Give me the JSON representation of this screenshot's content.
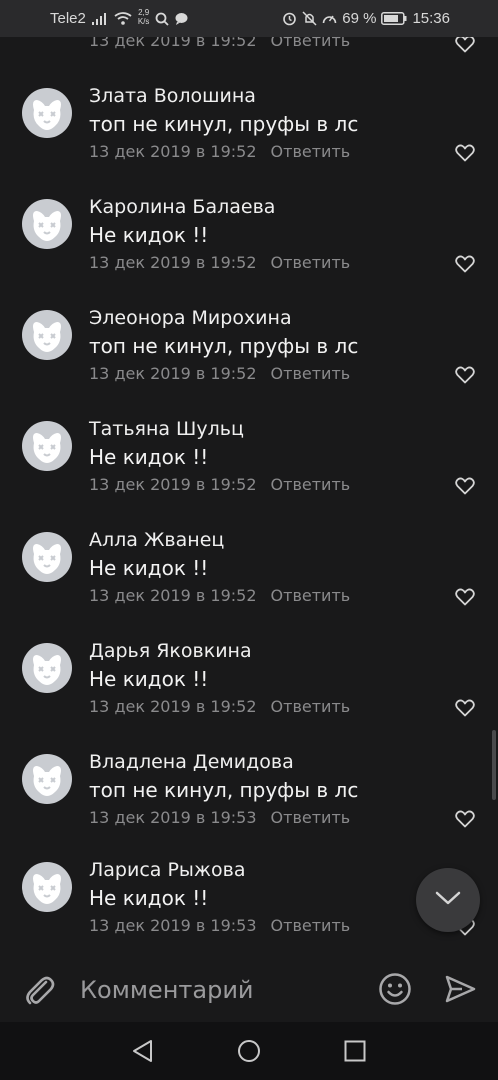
{
  "status_bar": {
    "carrier": "Tele2",
    "speed_value": "2,9",
    "speed_unit": "K/s",
    "battery": "69 %",
    "time": "15:36"
  },
  "comments": [
    {
      "author": "",
      "text": "",
      "date": "13 дек 2019 в 19:52",
      "reply": "Ответить",
      "partial": true
    },
    {
      "author": "Злата Волошина",
      "text": "топ не кинул, пруфы в лс",
      "date": "13 дек 2019 в 19:52",
      "reply": "Ответить"
    },
    {
      "author": "Каролина Балаева",
      "text": "Не кидок !!",
      "date": "13 дек 2019 в 19:52",
      "reply": "Ответить"
    },
    {
      "author": "Элеонора Мирохина",
      "text": "топ не кинул, пруфы в лс",
      "date": "13 дек 2019 в 19:52",
      "reply": "Ответить"
    },
    {
      "author": "Татьяна Шульц",
      "text": "Не кидок !!",
      "date": "13 дек 2019 в 19:52",
      "reply": "Ответить"
    },
    {
      "author": "Алла Жванец",
      "text": "Не кидок !!",
      "date": "13 дек 2019 в 19:52",
      "reply": "Ответить"
    },
    {
      "author": "Дарья Яковкина",
      "text": "Не кидок !!",
      "date": "13 дек 2019 в 19:52",
      "reply": "Ответить"
    },
    {
      "author": "Владлена Демидова",
      "text": "топ не кинул, пруфы в лс",
      "date": "13 дек 2019 в 19:53",
      "reply": "Ответить"
    },
    {
      "author": "Лариса Рыжова",
      "text": "Не кидок !!",
      "date": "13 дек 2019 в 19:53",
      "reply": "Ответить"
    }
  ],
  "composer": {
    "placeholder": "Комментарий"
  },
  "icons": {
    "attach": "paperclip-icon",
    "emoji": "smiley-icon",
    "send": "send-icon",
    "like": "heart-icon",
    "scroll_down": "chevron-down-icon",
    "nav_back": "triangle-back-icon",
    "nav_home": "circle-home-icon",
    "nav_recents": "square-recents-icon"
  },
  "colors": {
    "background": "#19191a",
    "meta_text": "#8a8a8c",
    "avatar": "#c9ccd1"
  }
}
